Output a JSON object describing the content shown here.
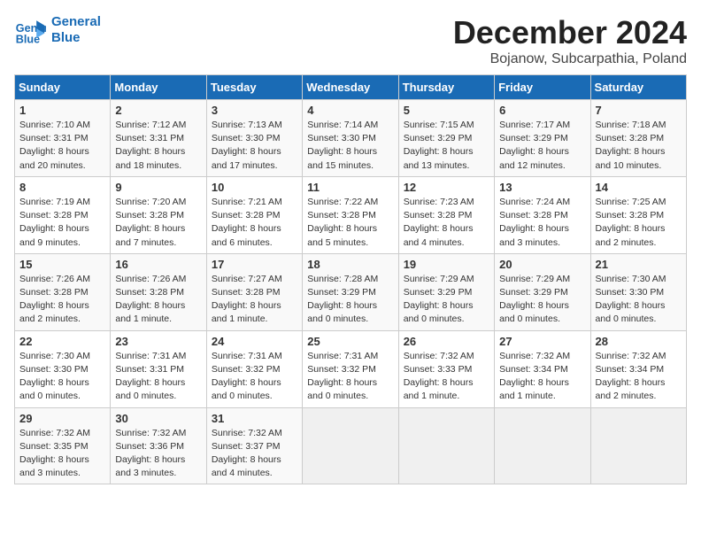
{
  "header": {
    "logo_line1": "General",
    "logo_line2": "Blue",
    "month": "December 2024",
    "location": "Bojanow, Subcarpathia, Poland"
  },
  "weekdays": [
    "Sunday",
    "Monday",
    "Tuesday",
    "Wednesday",
    "Thursday",
    "Friday",
    "Saturday"
  ],
  "weeks": [
    [
      {
        "day": "1",
        "sunrise": "7:10 AM",
        "sunset": "3:31 PM",
        "daylight": "8 hours and 20 minutes."
      },
      {
        "day": "2",
        "sunrise": "7:12 AM",
        "sunset": "3:31 PM",
        "daylight": "8 hours and 18 minutes."
      },
      {
        "day": "3",
        "sunrise": "7:13 AM",
        "sunset": "3:30 PM",
        "daylight": "8 hours and 17 minutes."
      },
      {
        "day": "4",
        "sunrise": "7:14 AM",
        "sunset": "3:30 PM",
        "daylight": "8 hours and 15 minutes."
      },
      {
        "day": "5",
        "sunrise": "7:15 AM",
        "sunset": "3:29 PM",
        "daylight": "8 hours and 13 minutes."
      },
      {
        "day": "6",
        "sunrise": "7:17 AM",
        "sunset": "3:29 PM",
        "daylight": "8 hours and 12 minutes."
      },
      {
        "day": "7",
        "sunrise": "7:18 AM",
        "sunset": "3:28 PM",
        "daylight": "8 hours and 10 minutes."
      }
    ],
    [
      {
        "day": "8",
        "sunrise": "7:19 AM",
        "sunset": "3:28 PM",
        "daylight": "8 hours and 9 minutes."
      },
      {
        "day": "9",
        "sunrise": "7:20 AM",
        "sunset": "3:28 PM",
        "daylight": "8 hours and 7 minutes."
      },
      {
        "day": "10",
        "sunrise": "7:21 AM",
        "sunset": "3:28 PM",
        "daylight": "8 hours and 6 minutes."
      },
      {
        "day": "11",
        "sunrise": "7:22 AM",
        "sunset": "3:28 PM",
        "daylight": "8 hours and 5 minutes."
      },
      {
        "day": "12",
        "sunrise": "7:23 AM",
        "sunset": "3:28 PM",
        "daylight": "8 hours and 4 minutes."
      },
      {
        "day": "13",
        "sunrise": "7:24 AM",
        "sunset": "3:28 PM",
        "daylight": "8 hours and 3 minutes."
      },
      {
        "day": "14",
        "sunrise": "7:25 AM",
        "sunset": "3:28 PM",
        "daylight": "8 hours and 2 minutes."
      }
    ],
    [
      {
        "day": "15",
        "sunrise": "7:26 AM",
        "sunset": "3:28 PM",
        "daylight": "8 hours and 2 minutes."
      },
      {
        "day": "16",
        "sunrise": "7:26 AM",
        "sunset": "3:28 PM",
        "daylight": "8 hours and 1 minute."
      },
      {
        "day": "17",
        "sunrise": "7:27 AM",
        "sunset": "3:28 PM",
        "daylight": "8 hours and 1 minute."
      },
      {
        "day": "18",
        "sunrise": "7:28 AM",
        "sunset": "3:29 PM",
        "daylight": "8 hours and 0 minutes."
      },
      {
        "day": "19",
        "sunrise": "7:29 AM",
        "sunset": "3:29 PM",
        "daylight": "8 hours and 0 minutes."
      },
      {
        "day": "20",
        "sunrise": "7:29 AM",
        "sunset": "3:29 PM",
        "daylight": "8 hours and 0 minutes."
      },
      {
        "day": "21",
        "sunrise": "7:30 AM",
        "sunset": "3:30 PM",
        "daylight": "8 hours and 0 minutes."
      }
    ],
    [
      {
        "day": "22",
        "sunrise": "7:30 AM",
        "sunset": "3:30 PM",
        "daylight": "8 hours and 0 minutes."
      },
      {
        "day": "23",
        "sunrise": "7:31 AM",
        "sunset": "3:31 PM",
        "daylight": "8 hours and 0 minutes."
      },
      {
        "day": "24",
        "sunrise": "7:31 AM",
        "sunset": "3:32 PM",
        "daylight": "8 hours and 0 minutes."
      },
      {
        "day": "25",
        "sunrise": "7:31 AM",
        "sunset": "3:32 PM",
        "daylight": "8 hours and 0 minutes."
      },
      {
        "day": "26",
        "sunrise": "7:32 AM",
        "sunset": "3:33 PM",
        "daylight": "8 hours and 1 minute."
      },
      {
        "day": "27",
        "sunrise": "7:32 AM",
        "sunset": "3:34 PM",
        "daylight": "8 hours and 1 minute."
      },
      {
        "day": "28",
        "sunrise": "7:32 AM",
        "sunset": "3:34 PM",
        "daylight": "8 hours and 2 minutes."
      }
    ],
    [
      {
        "day": "29",
        "sunrise": "7:32 AM",
        "sunset": "3:35 PM",
        "daylight": "8 hours and 3 minutes."
      },
      {
        "day": "30",
        "sunrise": "7:32 AM",
        "sunset": "3:36 PM",
        "daylight": "8 hours and 3 minutes."
      },
      {
        "day": "31",
        "sunrise": "7:32 AM",
        "sunset": "3:37 PM",
        "daylight": "8 hours and 4 minutes."
      },
      null,
      null,
      null,
      null
    ]
  ]
}
